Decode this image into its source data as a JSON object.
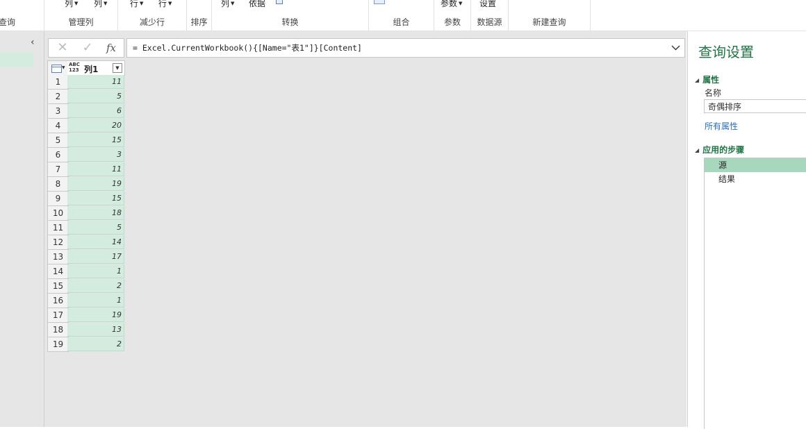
{
  "ribbon": {
    "groups": [
      {
        "label": "查询"
      },
      {
        "label": "管理列",
        "items": [
          "列",
          "列"
        ]
      },
      {
        "label": "减少行",
        "items": [
          "行",
          "行"
        ]
      },
      {
        "label": "排序"
      },
      {
        "label": "转换",
        "items": [
          "列",
          "依据"
        ]
      },
      {
        "label": "组合"
      },
      {
        "label": "参数",
        "items": [
          "参数"
        ]
      },
      {
        "label": "数据源",
        "items": [
          "设置"
        ]
      },
      {
        "label": "新建查询"
      }
    ]
  },
  "formula_bar": {
    "cancel_glyph": "✕",
    "confirm_glyph": "✓",
    "fx_label": "fx",
    "formula": "= Excel.CurrentWorkbook(){[Name=\"表1\"]}[Content]"
  },
  "grid": {
    "column": {
      "type_label_top": "ABC",
      "type_label_bottom": "123",
      "name": "列1"
    },
    "row_numbers": [
      "1",
      "2",
      "3",
      "4",
      "5",
      "6",
      "7",
      "8",
      "9",
      "10",
      "11",
      "12",
      "13",
      "14",
      "15",
      "16",
      "17",
      "18",
      "19"
    ],
    "values": [
      "11",
      "5",
      "6",
      "20",
      "15",
      "3",
      "11",
      "19",
      "15",
      "18",
      "5",
      "14",
      "17",
      "1",
      "2",
      "1",
      "19",
      "13",
      "2"
    ]
  },
  "settings": {
    "title": "查询设置",
    "properties_header": "属性",
    "name_label": "名称",
    "name_value": "奇偶排序",
    "all_properties_link": "所有属性",
    "steps_header": "应用的步骤",
    "steps": [
      {
        "label": "源",
        "active": true
      },
      {
        "label": "结果",
        "active": false
      }
    ]
  }
}
